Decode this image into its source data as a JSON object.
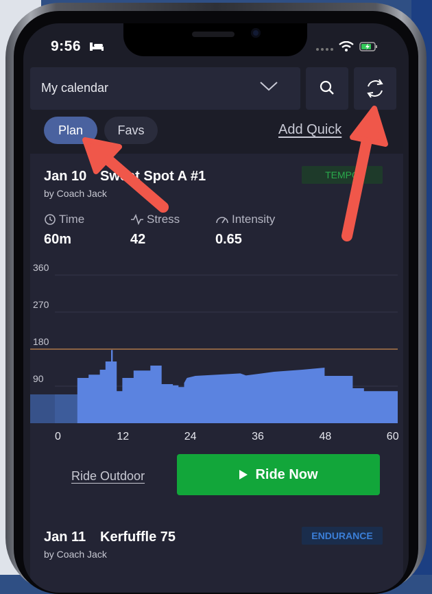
{
  "status_bar": {
    "time": "9:56"
  },
  "header": {
    "calendar_label": "My calendar"
  },
  "tabs": {
    "plan": "Plan",
    "favs": "Favs",
    "add_quick": "Add Quick"
  },
  "workouts": [
    {
      "date": "Jan 10",
      "name": "Sweet Spot A #1",
      "coach": "by Coach Jack",
      "tag": "TEMPO",
      "metrics": [
        {
          "label": "Time",
          "value": "60m",
          "icon": "clock-icon"
        },
        {
          "label": "Stress",
          "value": "42",
          "icon": "pulse-icon"
        },
        {
          "label": "Intensity",
          "value": "0.65",
          "icon": "gauge-icon"
        }
      ],
      "ride_outdoor": "Ride Outdoor",
      "ride_now": "Ride Now"
    },
    {
      "date": "Jan 11",
      "name": "Kerfuffle 75",
      "coach": "by Coach Jack",
      "tag": "ENDURANCE"
    }
  ],
  "colors": {
    "accent": "#4a629f",
    "ride_now": "#12a63a",
    "tempo": "#2aaa4c",
    "endurance": "#3b7fd8",
    "power_fill": "#5b83e0",
    "ftp_line": "#b07a4a",
    "annotation_arrow": "#f0574a"
  },
  "chart_data": {
    "type": "area",
    "x_ticks": [
      "0",
      "12",
      "24",
      "36",
      "48",
      "60"
    ],
    "y_ticks": [
      "90",
      "180",
      "270",
      "360"
    ],
    "xlim": [
      0,
      61
    ],
    "ylim": [
      0,
      375
    ],
    "ftp_line": 180,
    "points": [
      [
        0,
        0
      ],
      [
        0,
        70
      ],
      [
        4,
        70
      ],
      [
        4,
        110
      ],
      [
        6,
        110
      ],
      [
        6,
        118
      ],
      [
        8,
        118
      ],
      [
        8,
        130
      ],
      [
        9,
        130
      ],
      [
        9,
        150
      ],
      [
        10,
        150
      ],
      [
        10,
        178
      ],
      [
        10.3,
        178
      ],
      [
        10.3,
        150
      ],
      [
        11,
        150
      ],
      [
        11,
        78
      ],
      [
        12,
        78
      ],
      [
        12,
        110
      ],
      [
        14,
        110
      ],
      [
        14,
        128
      ],
      [
        17,
        128
      ],
      [
        17,
        140
      ],
      [
        19,
        140
      ],
      [
        19,
        95
      ],
      [
        21,
        95
      ],
      [
        21,
        92
      ],
      [
        22,
        92
      ],
      [
        22,
        90
      ],
      [
        22,
        88
      ],
      [
        23,
        88
      ],
      [
        23,
        98
      ],
      [
        23.5,
        110
      ],
      [
        25,
        115
      ],
      [
        33,
        121
      ],
      [
        34,
        116
      ],
      [
        39,
        125
      ],
      [
        44,
        130
      ],
      [
        48,
        135
      ],
      [
        48,
        115
      ],
      [
        53,
        115
      ],
      [
        53,
        85
      ],
      [
        55,
        85
      ],
      [
        55,
        78
      ],
      [
        61,
        78
      ],
      [
        61,
        0
      ]
    ],
    "warmup_band": {
      "x": [
        0,
        4
      ],
      "y": 70
    }
  }
}
